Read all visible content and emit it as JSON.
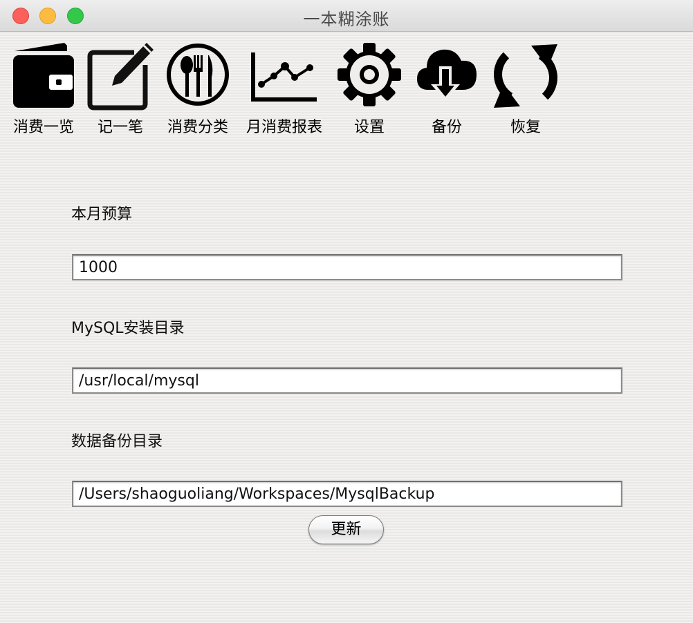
{
  "window": {
    "title": "一本糊涂账"
  },
  "toolbar": {
    "items": [
      {
        "label": "消费一览",
        "icon": "wallet-icon"
      },
      {
        "label": "记一笔",
        "icon": "edit-icon"
      },
      {
        "label": "消费分类",
        "icon": "dining-icon"
      },
      {
        "label": "月消费报表",
        "icon": "line-chart-icon"
      },
      {
        "label": "设置",
        "icon": "gear-icon"
      },
      {
        "label": "备份",
        "icon": "cloud-download-icon"
      },
      {
        "label": "恢复",
        "icon": "refresh-icon"
      }
    ]
  },
  "settings": {
    "budget_label": "本月预算",
    "budget_value": "1000",
    "mysql_label": "MySQL安装目录",
    "mysql_value": "/usr/local/mysql",
    "backup_label": "数据备份目录",
    "backup_value": "/Users/shaoguoliang/Workspaces/MysqlBackup",
    "update_button": "更新"
  },
  "colors": {
    "close": "#fc605b",
    "minimize": "#fdbc40",
    "maximize": "#34c84a"
  }
}
